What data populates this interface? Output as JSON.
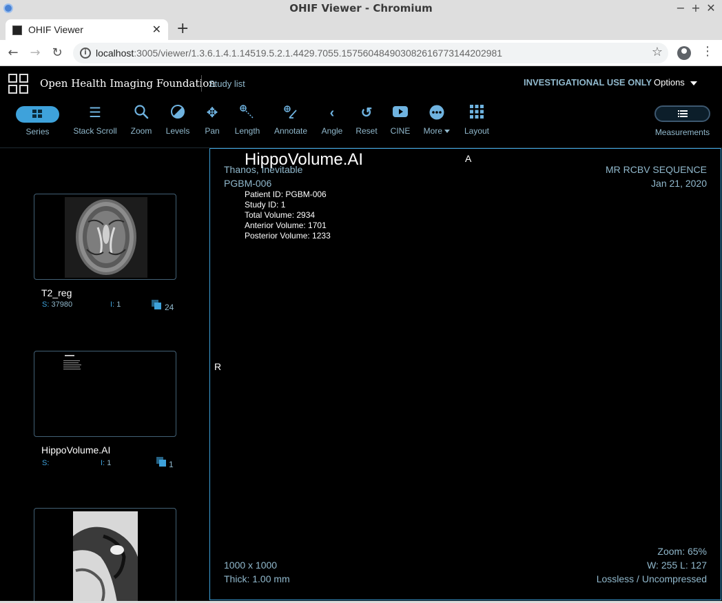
{
  "window": {
    "title": "OHIF Viewer - Chromium"
  },
  "browser": {
    "tab_title": "OHIF Viewer",
    "url_host": "localhost",
    "url_path": ":3005/viewer/1.3.6.1.4.1.14519.5.2.1.4429.7055.157560484903082616773144202981"
  },
  "header": {
    "brand": "Open Health Imaging Foundation",
    "study_list": "Study list",
    "investigational": "INVESTIGATIONAL USE ONLY",
    "options": "Options"
  },
  "toolbar": {
    "series": "Series",
    "tools": [
      {
        "label": "Stack Scroll",
        "icon": "stack-scroll-icon"
      },
      {
        "label": "Zoom",
        "icon": "zoom-icon"
      },
      {
        "label": "Levels",
        "icon": "levels-icon"
      },
      {
        "label": "Pan",
        "icon": "pan-icon"
      },
      {
        "label": "Length",
        "icon": "length-icon"
      },
      {
        "label": "Annotate",
        "icon": "annotate-icon"
      },
      {
        "label": "Angle",
        "icon": "angle-icon"
      },
      {
        "label": "Reset",
        "icon": "reset-icon"
      },
      {
        "label": "CINE",
        "icon": "cine-icon"
      },
      {
        "label": "More",
        "icon": "more-icon"
      },
      {
        "label": "Layout",
        "icon": "layout-icon"
      }
    ],
    "measurements": "Measurements"
  },
  "thumbnails": [
    {
      "name": "T2_reg",
      "s_label": "S:",
      "s_value": "37980",
      "i_label": "I:",
      "i_value": "1",
      "count": "24"
    },
    {
      "name": "HippoVolume.AI",
      "s_label": "S:",
      "s_value": "",
      "i_label": "I:",
      "i_value": "1",
      "count": "1"
    }
  ],
  "viewport": {
    "patient_name": "Thanos, Inevitable",
    "patient_id": "PGBM-006",
    "series_desc": "MR RCBV SEQUENCE",
    "study_date": "Jan 21, 2020",
    "orientation_top": "A",
    "orientation_left": "R",
    "dimensions": "1000 x 1000",
    "thickness": "Thick: 1.00 mm",
    "zoom": "Zoom: 65%",
    "window_level": "W: 255 L: 127",
    "compression": "Lossless / Uncompressed",
    "report": {
      "title": "HippoVolume.AI",
      "lines": [
        "Patient ID: PGBM-006",
        "Study ID: 1",
        "Total Volume: 2934",
        "Anterior Volume: 1701",
        "Posterior Volume: 1233"
      ]
    }
  }
}
